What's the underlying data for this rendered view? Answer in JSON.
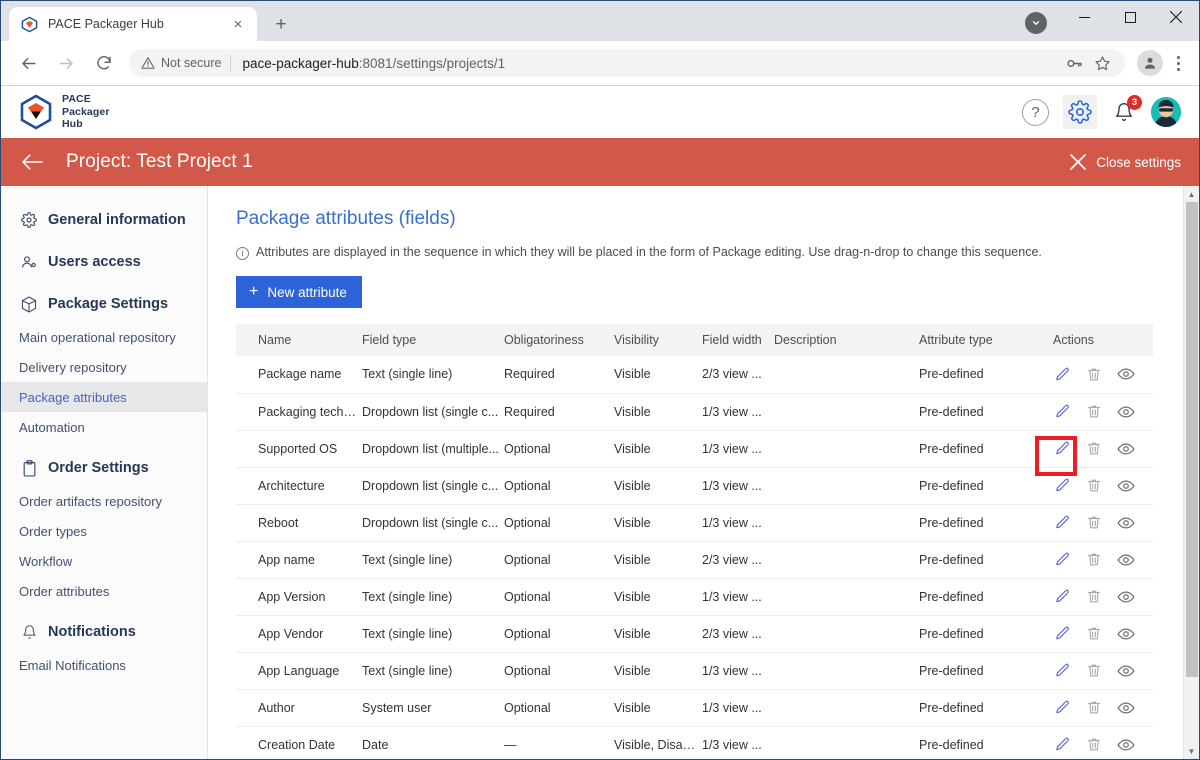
{
  "browser": {
    "tab": {
      "title": "PACE Packager Hub",
      "favicon": "pace-cube-icon",
      "close": "×"
    },
    "new_tab": "+",
    "window_controls": {
      "minimize": "−",
      "maximize": "▢",
      "close": "✕"
    },
    "tab_search": "chevron-down-icon",
    "nav": {
      "back": "←",
      "forward": "→",
      "reload": "⟳"
    },
    "omnibox": {
      "security_label": "Not secure",
      "url_host": "pace-packager-hub",
      "url_path": ":8081/settings/projects/1",
      "icons": [
        "key-icon",
        "star-icon"
      ]
    },
    "profile": "profile-avatar",
    "menu": "three-dot-menu-icon"
  },
  "app_header": {
    "brand_lines": [
      "PACE",
      "Packager",
      "Hub"
    ],
    "help_label": "?",
    "settings_icon": "gear-icon",
    "notifications": {
      "icon": "bell-icon",
      "count": "3"
    },
    "avatar": "user-avatar"
  },
  "project_bar": {
    "back": "←",
    "title": "Project: Test Project 1",
    "close_label": "Close settings",
    "close_icon": "✕",
    "bg_color": "#d2594a"
  },
  "sidebar": {
    "items": [
      {
        "label": "General information",
        "type": "group",
        "icon": "gear-icon",
        "active": false
      },
      {
        "label": "Users access",
        "type": "group",
        "icon": "users-icon",
        "active": false
      },
      {
        "label": "Package Settings",
        "type": "group",
        "icon": "cube-icon",
        "active": false
      },
      {
        "label": "Main operational repository",
        "type": "sub",
        "active": false
      },
      {
        "label": "Delivery repository",
        "type": "sub",
        "active": false
      },
      {
        "label": "Package attributes",
        "type": "sub",
        "active": true
      },
      {
        "label": "Automation",
        "type": "sub",
        "active": false
      },
      {
        "label": "Order Settings",
        "type": "group",
        "icon": "clipboard-icon",
        "active": false
      },
      {
        "label": "Order artifacts repository",
        "type": "sub",
        "active": false
      },
      {
        "label": "Order types",
        "type": "sub",
        "active": false
      },
      {
        "label": "Workflow",
        "type": "sub",
        "active": false
      },
      {
        "label": "Order attributes",
        "type": "sub",
        "active": false
      },
      {
        "label": "Notifications",
        "type": "group",
        "icon": "bell-icon",
        "active": false
      },
      {
        "label": "Email Notifications",
        "type": "sub",
        "active": false
      }
    ]
  },
  "main": {
    "page_title": "Package attributes (fields)",
    "hint_icon": "info-icon",
    "hint": "Attributes are displayed in the sequence in which they will be placed in the form of Package editing. Use drag-n-drop to change this sequence.",
    "new_attribute_button": "New attribute",
    "new_attribute_plus": "+",
    "accent_color": "#2d63d8",
    "title_color": "#3a6fd0"
  },
  "table": {
    "columns": [
      "Name",
      "Field type",
      "Obligatoriness",
      "Visibility",
      "Field width",
      "Description",
      "Attribute type",
      "Actions"
    ],
    "row_actions": [
      "edit-icon",
      "delete-icon",
      "visibility-icon"
    ],
    "rows": [
      {
        "name": "Package name",
        "field_type": "Text (single line)",
        "obligatoriness": "Required",
        "visibility": "Visible",
        "field_width": "2/3 view ...",
        "description": "",
        "attribute_type": "Pre-defined"
      },
      {
        "name": "Packaging technolo...",
        "field_type": "Dropdown list (single c...",
        "obligatoriness": "Required",
        "visibility": "Visible",
        "field_width": "1/3 view ...",
        "description": "",
        "attribute_type": "Pre-defined"
      },
      {
        "name": "Supported OS",
        "field_type": "Dropdown list (multiple...",
        "obligatoriness": "Optional",
        "visibility": "Visible",
        "field_width": "1/3 view ...",
        "description": "",
        "attribute_type": "Pre-defined"
      },
      {
        "name": "Architecture",
        "field_type": "Dropdown list (single c...",
        "obligatoriness": "Optional",
        "visibility": "Visible",
        "field_width": "1/3 view ...",
        "description": "",
        "attribute_type": "Pre-defined"
      },
      {
        "name": "Reboot",
        "field_type": "Dropdown list (single c...",
        "obligatoriness": "Optional",
        "visibility": "Visible",
        "field_width": "1/3 view ...",
        "description": "",
        "attribute_type": "Pre-defined"
      },
      {
        "name": "App name",
        "field_type": "Text (single line)",
        "obligatoriness": "Optional",
        "visibility": "Visible",
        "field_width": "2/3 view ...",
        "description": "",
        "attribute_type": "Pre-defined"
      },
      {
        "name": "App Version",
        "field_type": "Text (single line)",
        "obligatoriness": "Optional",
        "visibility": "Visible",
        "field_width": "1/3 view ...",
        "description": "",
        "attribute_type": "Pre-defined"
      },
      {
        "name": "App Vendor",
        "field_type": "Text (single line)",
        "obligatoriness": "Optional",
        "visibility": "Visible",
        "field_width": "2/3 view ...",
        "description": "",
        "attribute_type": "Pre-defined"
      },
      {
        "name": "App Language",
        "field_type": "Text (single line)",
        "obligatoriness": "Optional",
        "visibility": "Visible",
        "field_width": "1/3 view ...",
        "description": "",
        "attribute_type": "Pre-defined"
      },
      {
        "name": "Author",
        "field_type": "System user",
        "obligatoriness": "Optional",
        "visibility": "Visible",
        "field_width": "1/3 view ...",
        "description": "",
        "attribute_type": "Pre-defined"
      },
      {
        "name": "Creation Date",
        "field_type": "Date",
        "obligatoriness": "—",
        "visibility": "Visible, Disabl...",
        "field_width": "1/3 view ...",
        "description": "",
        "attribute_type": "Pre-defined"
      }
    ]
  },
  "highlight": {
    "target": "edit-icon on Architecture row",
    "color": "#ee1c25"
  }
}
